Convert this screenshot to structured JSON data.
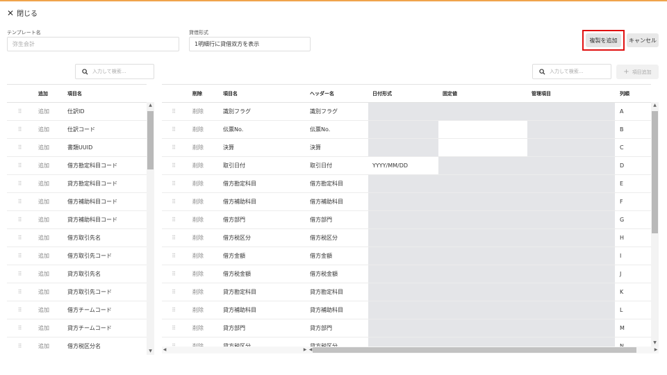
{
  "close_label": "閉じる",
  "template": {
    "label": "テンプレート名",
    "value": "弥生会計"
  },
  "format": {
    "label": "貸借形式",
    "value": "1明細行に貸借双方を表示"
  },
  "buttons": {
    "duplicate": "複製を追加",
    "cancel": "キャンセル",
    "add_item": "項目追加"
  },
  "search": {
    "left_placeholder": "入力して検索...",
    "right_placeholder": "入力して検索..."
  },
  "left_table": {
    "headers": [
      "追加",
      "項目名"
    ],
    "rows": [
      {
        "action": "追加",
        "name": "仕訳ID"
      },
      {
        "action": "追加",
        "name": "仕訳コード"
      },
      {
        "action": "追加",
        "name": "書類UUID"
      },
      {
        "action": "追加",
        "name": "借方勘定科目コード"
      },
      {
        "action": "追加",
        "name": "貸方勘定科目コード"
      },
      {
        "action": "追加",
        "name": "借方補助科目コード"
      },
      {
        "action": "追加",
        "name": "貸方補助科目コード"
      },
      {
        "action": "追加",
        "name": "借方取引先名"
      },
      {
        "action": "追加",
        "name": "借方取引先コード"
      },
      {
        "action": "追加",
        "name": "貸方取引先名"
      },
      {
        "action": "追加",
        "name": "貸方取引先コード"
      },
      {
        "action": "追加",
        "name": "借方チームコード"
      },
      {
        "action": "追加",
        "name": "貸方チームコード"
      },
      {
        "action": "追加",
        "name": "借方税区分名"
      }
    ]
  },
  "right_table": {
    "headers": [
      "削除",
      "項目名",
      "ヘッダー名",
      "日付形式",
      "固定値",
      "管理項目",
      "列順"
    ],
    "rows": [
      {
        "action": "削除",
        "name": "識別フラグ",
        "header": "識別フラグ",
        "date": "",
        "fixed": "",
        "manage": "",
        "col": "A"
      },
      {
        "action": "削除",
        "name": "伝票No.",
        "header": "伝票No.",
        "date": "",
        "fixed": "",
        "manage": "",
        "col": "B"
      },
      {
        "action": "削除",
        "name": "決算",
        "header": "決算",
        "date": "",
        "fixed": "",
        "manage": "",
        "col": "C"
      },
      {
        "action": "削除",
        "name": "取引日付",
        "header": "取引日付",
        "date": "YYYY/MM/DD",
        "fixed": "",
        "manage": "",
        "col": "D"
      },
      {
        "action": "削除",
        "name": "借方勘定科目",
        "header": "借方勘定科目",
        "date": "",
        "fixed": "",
        "manage": "",
        "col": "E"
      },
      {
        "action": "削除",
        "name": "借方補助科目",
        "header": "借方補助科目",
        "date": "",
        "fixed": "",
        "manage": "",
        "col": "F"
      },
      {
        "action": "削除",
        "name": "借方部門",
        "header": "借方部門",
        "date": "",
        "fixed": "",
        "manage": "",
        "col": "G"
      },
      {
        "action": "削除",
        "name": "借方税区分",
        "header": "借方税区分",
        "date": "",
        "fixed": "",
        "manage": "",
        "col": "H"
      },
      {
        "action": "削除",
        "name": "借方金額",
        "header": "借方金額",
        "date": "",
        "fixed": "",
        "manage": "",
        "col": "I"
      },
      {
        "action": "削除",
        "name": "借方税金額",
        "header": "借方税金額",
        "date": "",
        "fixed": "",
        "manage": "",
        "col": "J"
      },
      {
        "action": "削除",
        "name": "貸方勘定科目",
        "header": "貸方勘定科目",
        "date": "",
        "fixed": "",
        "manage": "",
        "col": "K"
      },
      {
        "action": "削除",
        "name": "貸方補助科目",
        "header": "貸方補助科目",
        "date": "",
        "fixed": "",
        "manage": "",
        "col": "L"
      },
      {
        "action": "削除",
        "name": "貸方部門",
        "header": "貸方部門",
        "date": "",
        "fixed": "",
        "manage": "",
        "col": "M"
      },
      {
        "action": "削除",
        "name": "貸方税区分",
        "header": "貸方税区分",
        "date": "",
        "fixed": "",
        "manage": "",
        "col": "N"
      }
    ]
  },
  "colors": {
    "accent_top": "#f0a44b",
    "highlight_border": "#e01010",
    "disabled_cell": "#e4e5e8"
  },
  "icons": {
    "close": "close-icon",
    "search": "search-icon",
    "drag": "drag-handle-icon",
    "plus": "plus-icon"
  }
}
